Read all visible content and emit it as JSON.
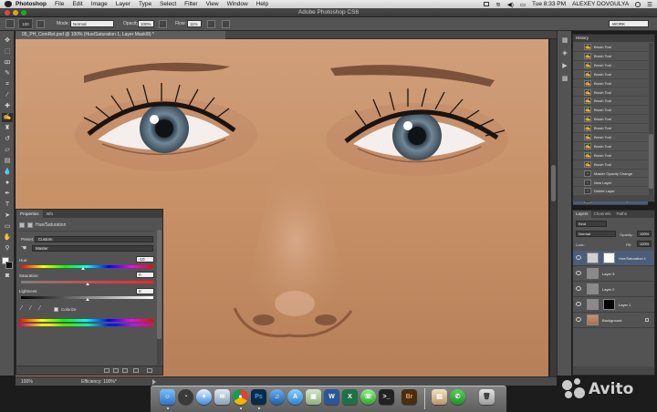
{
  "menubar": {
    "app_name": "Photoshop",
    "items": [
      "File",
      "Edit",
      "Image",
      "Layer",
      "Type",
      "Select",
      "Filter",
      "View",
      "Window",
      "Help"
    ],
    "clock": "Tue 8:33 PM",
    "user": "ALEXEY DOVGULYA"
  },
  "window": {
    "title": "Adobe Photoshop CS6"
  },
  "options": {
    "brush_size": "100",
    "mode_label": "Mode:",
    "mode_value": "Normal",
    "opacity_label": "Opacity:",
    "opacity_value": "100%",
    "flow_label": "Flow:",
    "flow_value": "11%",
    "workspace": "WORK"
  },
  "document": {
    "tab_title": "05_PH_ComRet.psd @ 100% (Hue/Saturation 1, Layer Mask/8) *",
    "zoom": "100%",
    "efficiency": "Efficiency: 100%*"
  },
  "properties": {
    "tabs": [
      "Properties",
      "Info"
    ],
    "title": "Hue/Saturation",
    "preset_label": "Preset:",
    "preset_value": "Custom",
    "channel_value": "Master",
    "hue_label": "Hue:",
    "hue_value": "-10",
    "hue_level": 0.47,
    "saturation_label": "Saturation:",
    "saturation_value": "0",
    "saturation_level": 0.5,
    "lightness_label": "Lightness:",
    "lightness_value": "0",
    "lightness_level": 0.5,
    "colorize_label": "Colorize"
  },
  "history": {
    "tab": "History",
    "items": [
      "Brush Tool",
      "Brush Tool",
      "Brush Tool",
      "Brush Tool",
      "Brush Tool",
      "Brush Tool",
      "Brush Tool",
      "Brush Tool",
      "Brush Tool",
      "Brush Tool",
      "Brush Tool",
      "Brush Tool",
      "Brush Tool",
      "Brush Tool",
      "Master Opacity Change",
      "New Layer",
      "Delete Layer",
      "Hue/Saturation 1 Layer"
    ],
    "selected_index": 17
  },
  "layers": {
    "tabs": [
      "Layers",
      "Channels",
      "Paths"
    ],
    "kind_label": "Kind",
    "blend_mode": "Normal",
    "opacity_label": "Opacity:",
    "opacity_value": "100%",
    "lock_label": "Lock:",
    "fill_label": "Fill:",
    "fill_value": "100%",
    "items": [
      {
        "name": "Hue/Saturation 1",
        "selected": true
      },
      {
        "name": "Layer 3",
        "selected": false
      },
      {
        "name": "Layer 2",
        "selected": false
      },
      {
        "name": "Layer 1",
        "selected": false
      },
      {
        "name": "Background",
        "selected": false
      }
    ]
  },
  "dock": {
    "apps": [
      "finder-icon",
      "dashboard-icon",
      "safari-icon",
      "mail-icon",
      "chrome-icon",
      "photoshop-icon",
      "itunes-icon",
      "app-store-icon",
      "preview-icon",
      "word-icon",
      "excel-icon",
      "messages-icon",
      "terminal-icon",
      "bridge-icon",
      "photo-icon",
      "facetime-icon",
      "trash-icon"
    ],
    "photoshop_label": "Ps",
    "bridge_label": "Br",
    "word_label": "W"
  },
  "watermark": {
    "text": "Avito"
  },
  "colors": {
    "panel_bg": "#535353",
    "selection": "#4b5d78",
    "skin": "#c89470"
  }
}
